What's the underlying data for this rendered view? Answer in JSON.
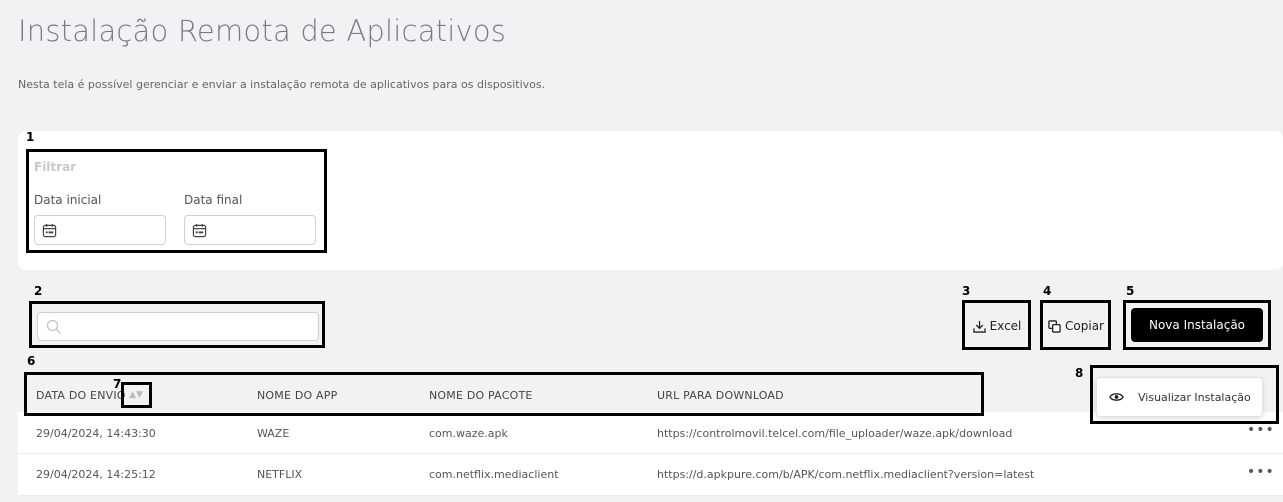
{
  "page": {
    "title": "Instalação Remota de Aplicativos",
    "subtitle": "Nesta tela é possível gerenciar e enviar a instalação remota de aplicativos para os dispositivos."
  },
  "filter": {
    "title": "Filtrar",
    "start_label": "Data inicial",
    "end_label": "Data final",
    "start_value": "",
    "end_value": ""
  },
  "search": {
    "placeholder": ""
  },
  "toolbar": {
    "excel_label": "Excel",
    "copy_label": "Copiar",
    "new_label": "Nova Instalação"
  },
  "table": {
    "columns": [
      "DATA DO ENVIO",
      "NOME DO APP",
      "NOME DO PACOTE",
      "URL PARA DOWNLOAD"
    ],
    "rows": [
      [
        "29/04/2024, 14:43:30",
        "WAZE",
        "com.waze.apk",
        "https://controlmovil.telcel.com/file_uploader/waze.apk/download"
      ],
      [
        "29/04/2024, 14:25:12",
        "NETFLIX",
        "com.netflix.mediaclient",
        "https://d.apkpure.com/b/APK/com.netflix.mediaclient?version=latest"
      ]
    ]
  },
  "row_menu": {
    "view_label": "Visualizar Instalação"
  },
  "annotations": [
    "1",
    "2",
    "3",
    "4",
    "5",
    "6",
    "7",
    "8"
  ],
  "icons": [
    "calendar-icon",
    "search-icon",
    "download-icon",
    "copy-icon",
    "sort-icon",
    "more-icon",
    "eye-icon"
  ]
}
